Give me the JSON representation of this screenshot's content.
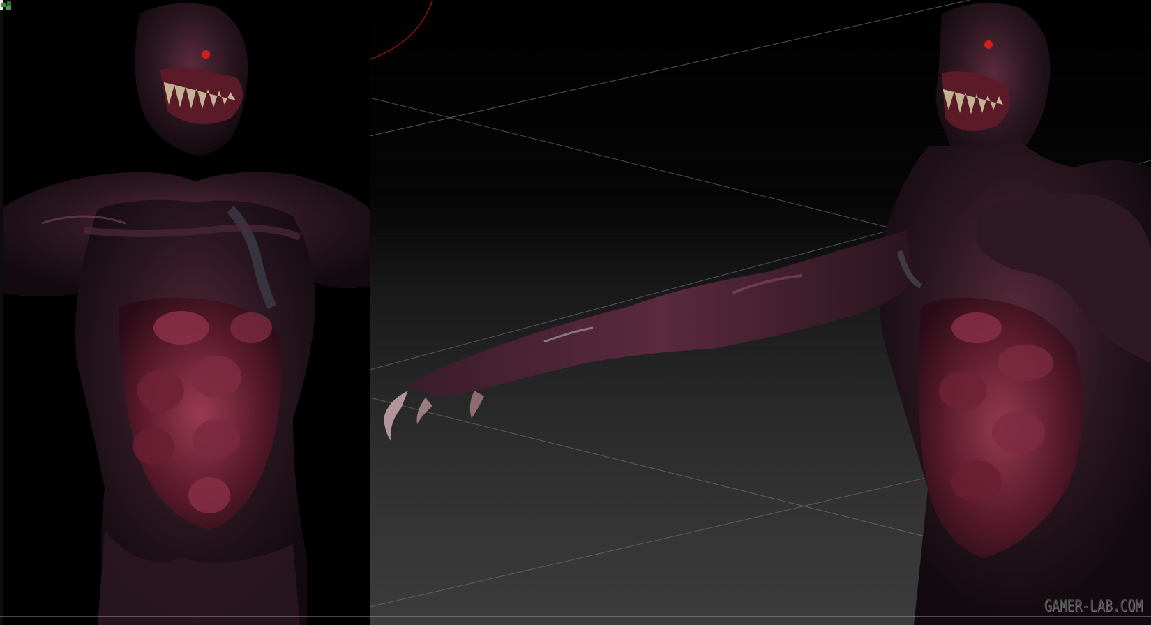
{
  "scene": {
    "description_type": "3D sculpt render of a symbiote creature, two views",
    "colors": {
      "skin_dark": "#1a1116",
      "skin_highlight": "#8a4a62",
      "flesh_red": "#6a1a2a",
      "teeth": "#cfc3a0",
      "eye_red": "#d0201a"
    }
  },
  "watermark": {
    "text": "GAMER-LAB.COM",
    "icon": "gamer-lab-logo-icon"
  }
}
